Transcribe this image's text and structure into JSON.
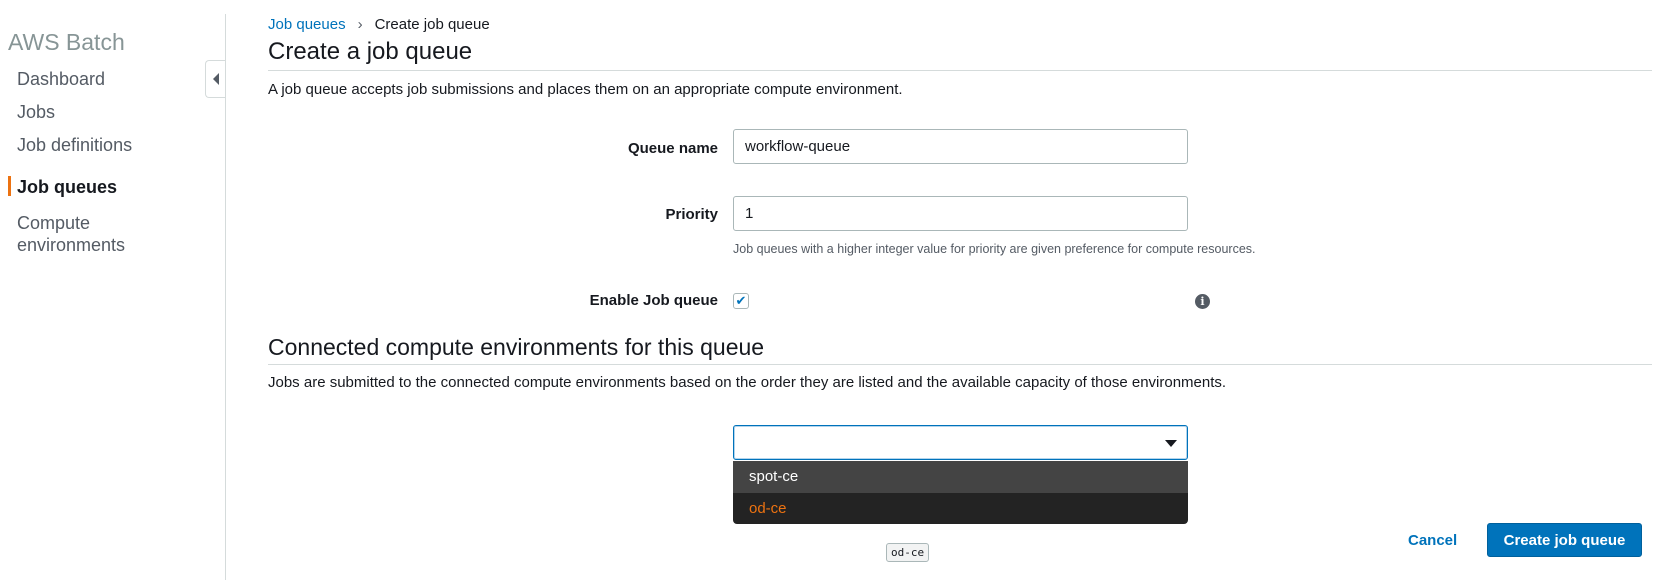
{
  "sidebar": {
    "title": "AWS Batch",
    "items": [
      {
        "label": "Dashboard"
      },
      {
        "label": "Jobs"
      },
      {
        "label": "Job definitions"
      },
      {
        "label": "Job queues"
      },
      {
        "label": "Compute\nenvironments"
      }
    ]
  },
  "breadcrumb": {
    "parent": "Job queues",
    "current": "Create job queue"
  },
  "page": {
    "title": "Create a job queue",
    "description": "A job queue accepts job submissions and places them on an appropriate compute environment."
  },
  "form": {
    "queue_name_label": "Queue name",
    "queue_name_value": "workflow-queue",
    "priority_label": "Priority",
    "priority_value": "1",
    "priority_hint": "Job queues with a higher integer value for priority are given preference for compute resources.",
    "enable_label": "Enable Job queue",
    "enable_checked": true,
    "checkmark": "✔",
    "info_glyph": "i"
  },
  "compute": {
    "title": "Connected compute environments for this queue",
    "description": "Jobs are submitted to the connected compute environments based on the order they are listed and the available capacity of those environments.",
    "select_value": "",
    "options": [
      "spot-ce",
      "od-ce"
    ],
    "tooltip": "od-ce"
  },
  "actions": {
    "cancel": "Cancel",
    "create": "Create job queue"
  },
  "colors": {
    "link": "#0073bb",
    "accent": "#ec7211",
    "primary": "#0073bb"
  }
}
